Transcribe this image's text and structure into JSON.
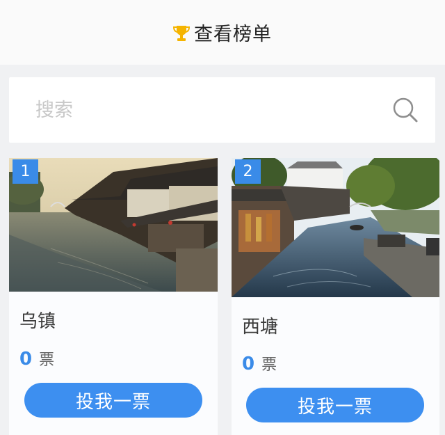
{
  "header": {
    "title": "查看榜单",
    "icon": "trophy-icon",
    "icon_color": "#f5b400"
  },
  "search": {
    "placeholder": "搜索",
    "icon": "search-icon"
  },
  "accent_color": "#3a8be8",
  "candidates": [
    {
      "rank": "1",
      "name": "乌镇",
      "votes": "0",
      "unit": "票",
      "button": "投我一票"
    },
    {
      "rank": "2",
      "name": "西塘",
      "votes": "0",
      "unit": "票",
      "button": "投我一票"
    }
  ]
}
